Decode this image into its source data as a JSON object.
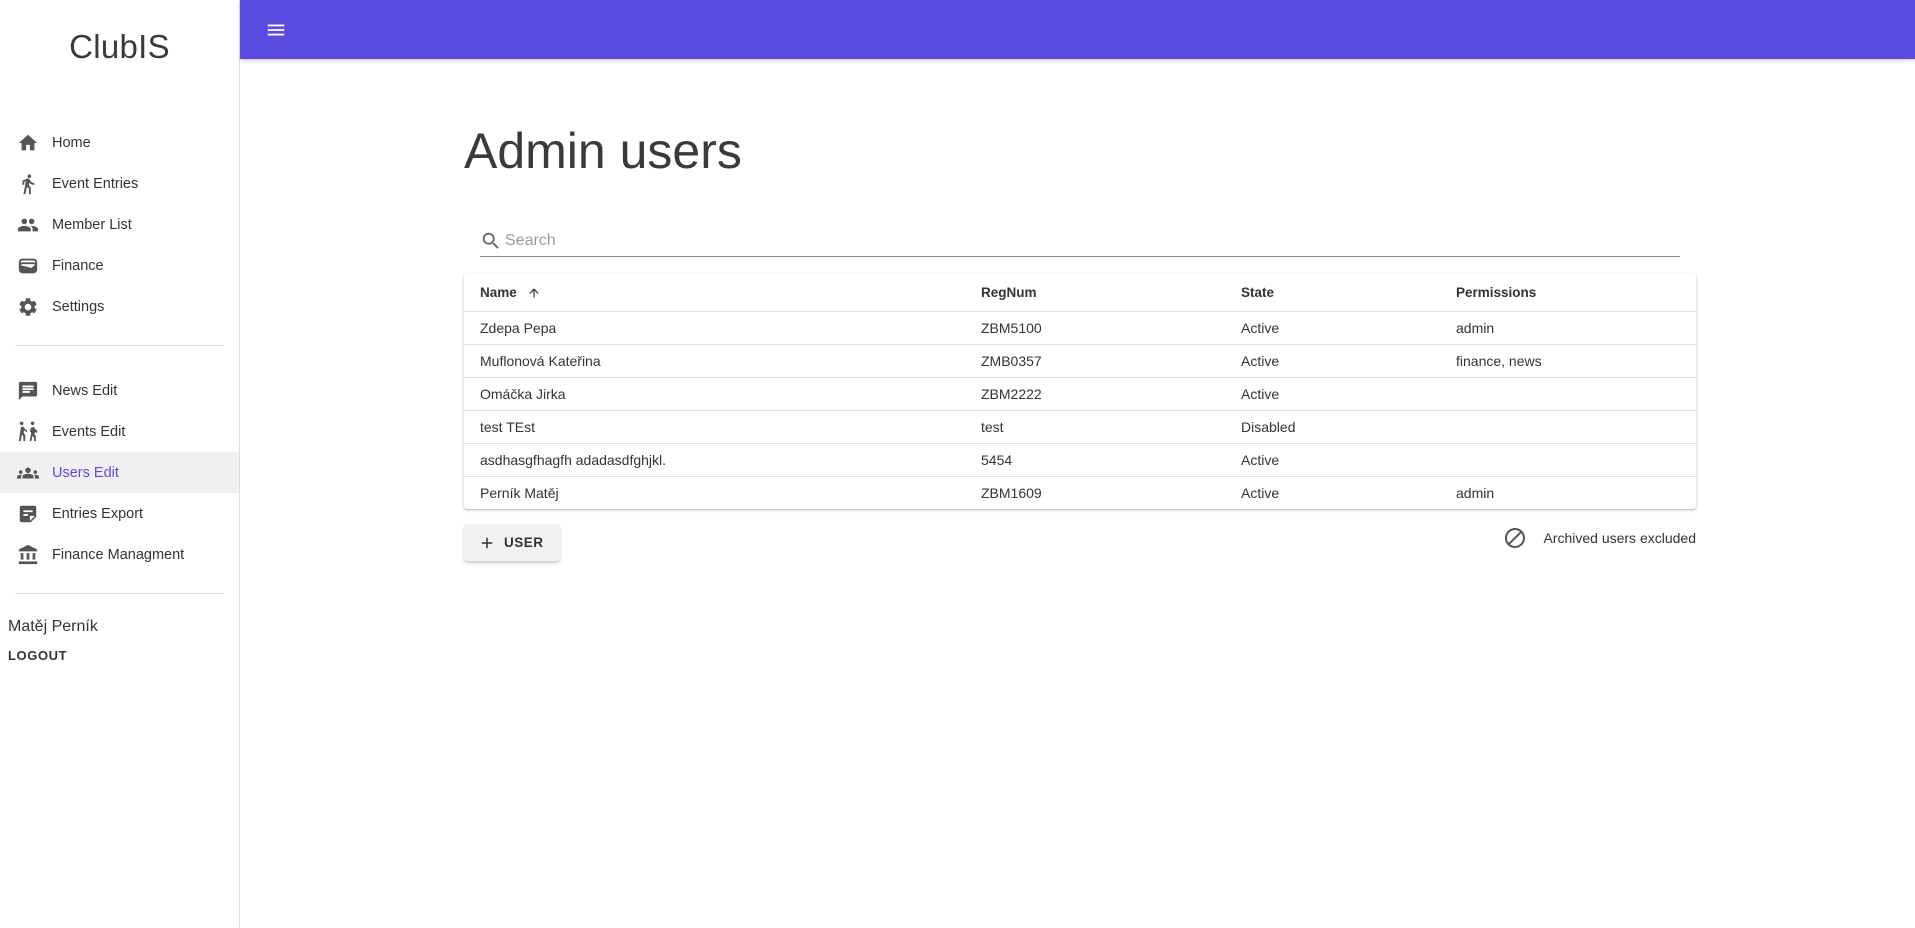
{
  "app": {
    "brand": "ClubIS"
  },
  "sidebar": {
    "primary": [
      {
        "label": "Home",
        "icon": "home-icon"
      },
      {
        "label": "Event Entries",
        "icon": "run-icon"
      },
      {
        "label": "Member List",
        "icon": "people-icon"
      },
      {
        "label": "Finance",
        "icon": "wallet-icon"
      },
      {
        "label": "Settings",
        "icon": "gear-icon"
      }
    ],
    "admin": [
      {
        "label": "News Edit",
        "icon": "message-icon"
      },
      {
        "label": "Events Edit",
        "icon": "handoff-icon"
      },
      {
        "label": "Users Edit",
        "icon": "group-icon",
        "active": true
      },
      {
        "label": "Entries Export",
        "icon": "note-icon"
      },
      {
        "label": "Finance Managment",
        "icon": "bank-icon"
      }
    ],
    "user_name": "Matěj Perník",
    "logout_label": "LOGOUT"
  },
  "topbar": {
    "color": "#5b4be0",
    "menu_icon": "menu-icon"
  },
  "main": {
    "title": "Admin users",
    "search": {
      "placeholder": "Search",
      "value": ""
    },
    "table": {
      "columns": [
        "Name",
        "RegNum",
        "State",
        "Permissions"
      ],
      "sort": {
        "column": "Name",
        "direction": "ascending"
      },
      "rows": [
        [
          "Zdepa Pepa",
          "ZBM5100",
          "Active",
          "admin"
        ],
        [
          "Muflonová Kateřina",
          "ZMB0357",
          "Active",
          "finance, news"
        ],
        [
          "Omáčka Jirka",
          "ZBM2222",
          "Active",
          ""
        ],
        [
          "test TEst",
          "test",
          "Disabled",
          ""
        ],
        [
          "asdhasgfhagfh adadasdfghjkl.",
          "5454",
          "Active",
          ""
        ],
        [
          "Perník Matěj",
          "ZBM1609",
          "Active",
          "admin"
        ]
      ]
    },
    "add_button_label": "USER",
    "archived_label": "Archived users excluded"
  }
}
